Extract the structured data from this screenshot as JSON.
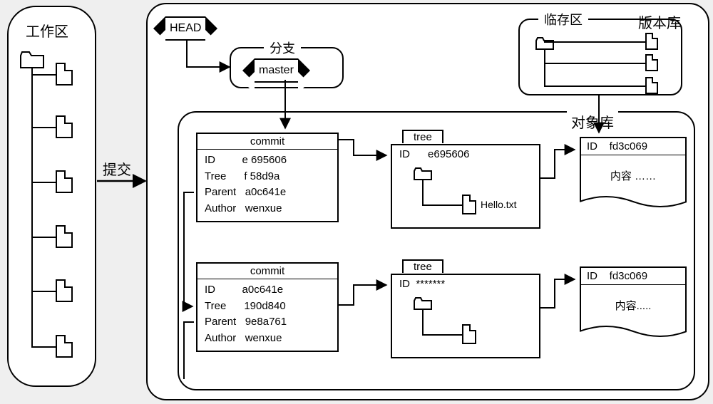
{
  "workdir": {
    "title": "工作区"
  },
  "submit_label": "提交",
  "repo": {
    "title": "版本库",
    "head_label": "HEAD",
    "branch_section_label": "分支",
    "branch_name": "master",
    "staging_label": "临存区",
    "objectstore_label": "对象库"
  },
  "commits": [
    {
      "header": "commit",
      "id_label": "ID",
      "id": "e 695606",
      "tree_label": "Tree",
      "tree": "f 58d9a",
      "parent_label": "Parent",
      "parent": "a0c641e",
      "author_label": "Author",
      "author": "wenxue"
    },
    {
      "header": "commit",
      "id_label": "ID",
      "id": "a0c641e",
      "tree_label": "Tree",
      "tree": "190d840",
      "parent_label": "Parent",
      "parent": "9e8a761",
      "author_label": "Author",
      "author": "wenxue"
    }
  ],
  "trees": [
    {
      "tab": "tree",
      "id_label": "ID",
      "id": "e695606",
      "filename": "Hello.txt"
    },
    {
      "tab": "tree",
      "id_label": "ID",
      "id": "*******",
      "filename": ""
    }
  ],
  "blobs": [
    {
      "id_label": "ID",
      "id": "fd3c069",
      "content": "内容 ……"
    },
    {
      "id_label": "ID",
      "id": "fd3c069",
      "content": "内容....."
    }
  ]
}
